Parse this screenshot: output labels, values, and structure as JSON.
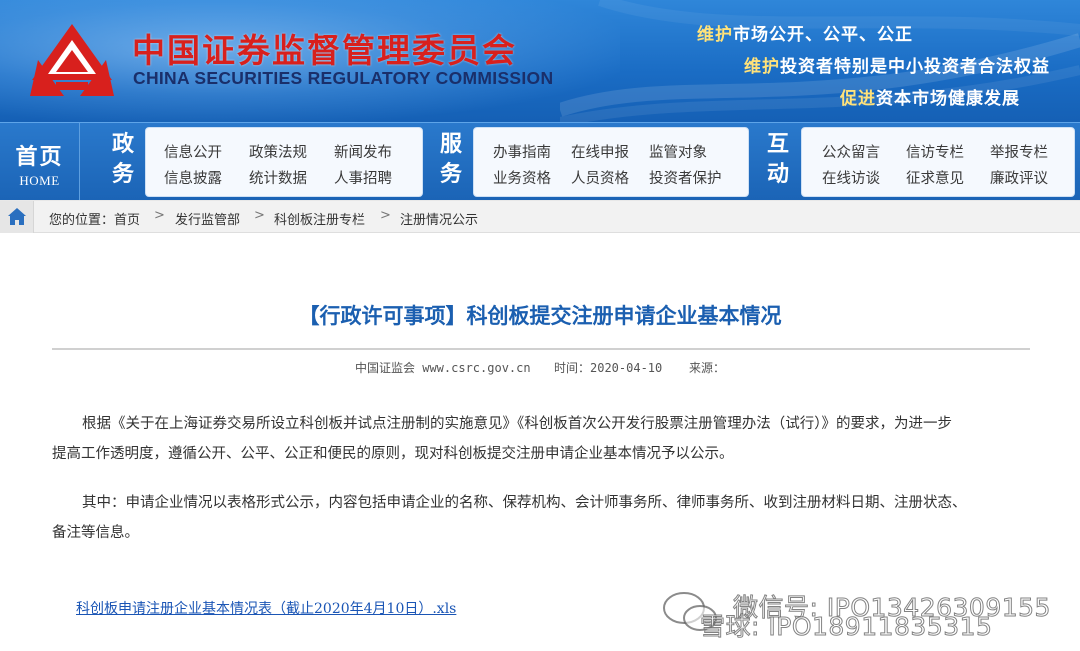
{
  "header": {
    "title_cn": "中国证券监督管理委员会",
    "title_en": "CHINA SECURITIES REGULATORY COMMISSION",
    "slogans": [
      {
        "prefix": "维护",
        "rest": "市场公开、公平、公正"
      },
      {
        "prefix": "维护",
        "rest": "投资者特别是中小投资者合法权益"
      },
      {
        "prefix": "促进",
        "rest": "资本市场健康发展"
      }
    ]
  },
  "nav": {
    "home_cn": "首页",
    "home_en": "HOME",
    "groups": [
      {
        "label_top": "政",
        "label_bottom": "务",
        "links": [
          "信息公开",
          "政策法规",
          "新闻发布",
          "信息披露",
          "统计数据",
          "人事招聘"
        ]
      },
      {
        "label_top": "服",
        "label_bottom": "务",
        "links": [
          "办事指南",
          "在线申报",
          "监管对象",
          "业务资格",
          "人员资格",
          "投资者保护"
        ]
      },
      {
        "label_top": "互",
        "label_bottom": "动",
        "links": [
          "公众留言",
          "信访专栏",
          "举报专栏",
          "在线访谈",
          "征求意见",
          "廉政评议"
        ]
      }
    ]
  },
  "breadcrumb": {
    "items": [
      "您的位置：首页",
      "发行监管部",
      "科创板注册专栏",
      "注册情况公示"
    ],
    "separator": ">"
  },
  "article": {
    "title": "【行政许可事项】科创板提交注册申请企业基本情况",
    "meta_source": "中国证监会 www.csrc.gov.cn",
    "meta_time": "时间：2020-04-10",
    "meta_origin": "来源：",
    "para1_line1": "根据《关于在上海证券交易所设立科创板并试点注册制的实施意见》《科创板首次公开发行股票注册管理办法（试行）》的要求，为进一步",
    "para1_line2": "提高工作透明度，遵循公开、公平、公正和便民的原则，现对科创板提交注册申请企业基本情况予以公示。",
    "para2_line1": "其中：申请企业情况以表格形式公示，内容包括申请企业的名称、保荐机构、会计师事务所、律师事务所、收到注册材料日期、注册状态、",
    "para2_line2": "备注等信息。",
    "attachment": "科创板申请注册企业基本情况表（截止2020年4月10日）.xls"
  },
  "watermark": {
    "line1": "微信号: IPO13426309155",
    "line2": "雪球: IPO18911835315"
  },
  "colors": {
    "banner_blue": "#1a6cc4",
    "title_red": "#d8201d",
    "article_title_blue": "#1b5fb0",
    "link_blue": "#1a55b5"
  }
}
